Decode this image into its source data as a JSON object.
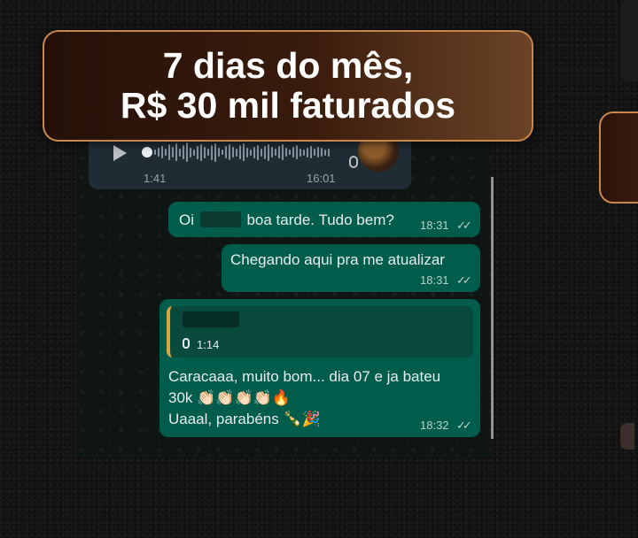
{
  "headline": {
    "line1": "7 dias do mês,",
    "line2": "R$ 30 mil faturados"
  },
  "colors": {
    "accent_border": "#c9874c",
    "outgoing_bubble": "#005c4b",
    "incoming_bubble": "#202c33",
    "quote_bar": "#d9a63f"
  },
  "audio_message": {
    "duration": "1:41",
    "timestamp": "16:01",
    "play_icon": "play-icon",
    "mic_icon": "mic-icon"
  },
  "messages": [
    {
      "text_before": "Oi",
      "text_after": "boa tarde. Tudo bem?",
      "time": "18:31",
      "status": "✓✓"
    },
    {
      "text": "Chegando aqui pra me atualizar",
      "time": "18:31",
      "status": "✓✓"
    },
    {
      "quoted_audio_duration": "1:14",
      "line1": "Caracaaa, muito bom... dia 07 e ja bateu",
      "line2": "30k 👏🏻👏🏻👏🏻👏🏻🔥",
      "line3": "Uaaal, parabéns 🍾🎉",
      "time": "18:32",
      "status": "✓✓"
    }
  ]
}
